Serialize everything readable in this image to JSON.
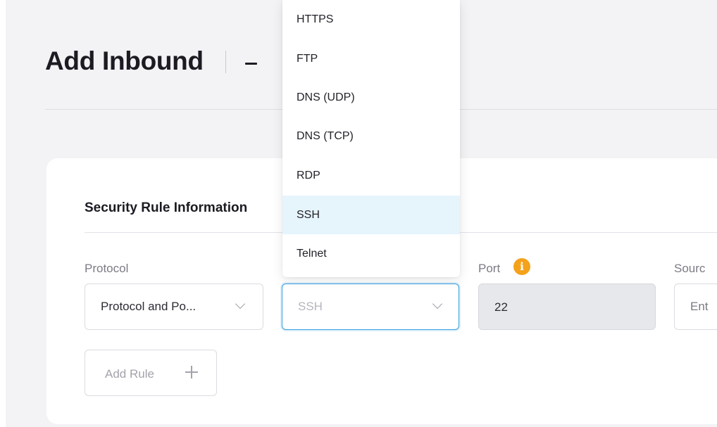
{
  "header": {
    "title": "Add Inbound"
  },
  "section": {
    "title": "Security Rule Information"
  },
  "fields": {
    "protocol_label": "Protocol",
    "protocol_value": "Protocol and Po...",
    "service_value": "SSH",
    "port_label": "Port",
    "port_value": "22",
    "source_label": "Sourc",
    "source_placeholder": "Ent"
  },
  "info_icon": {
    "glyph": "i",
    "color": "#f4a21b"
  },
  "add_rule_label": "Add Rule",
  "dropdown": {
    "selected": "SSH",
    "options": [
      "HTTPS",
      "FTP",
      "DNS (UDP)",
      "DNS (TCP)",
      "RDP",
      "SSH",
      "Telnet"
    ]
  },
  "colors": {
    "accent": "#3aa0e0",
    "selected_bg": "#e6f4fc",
    "info": "#f4a21b"
  }
}
